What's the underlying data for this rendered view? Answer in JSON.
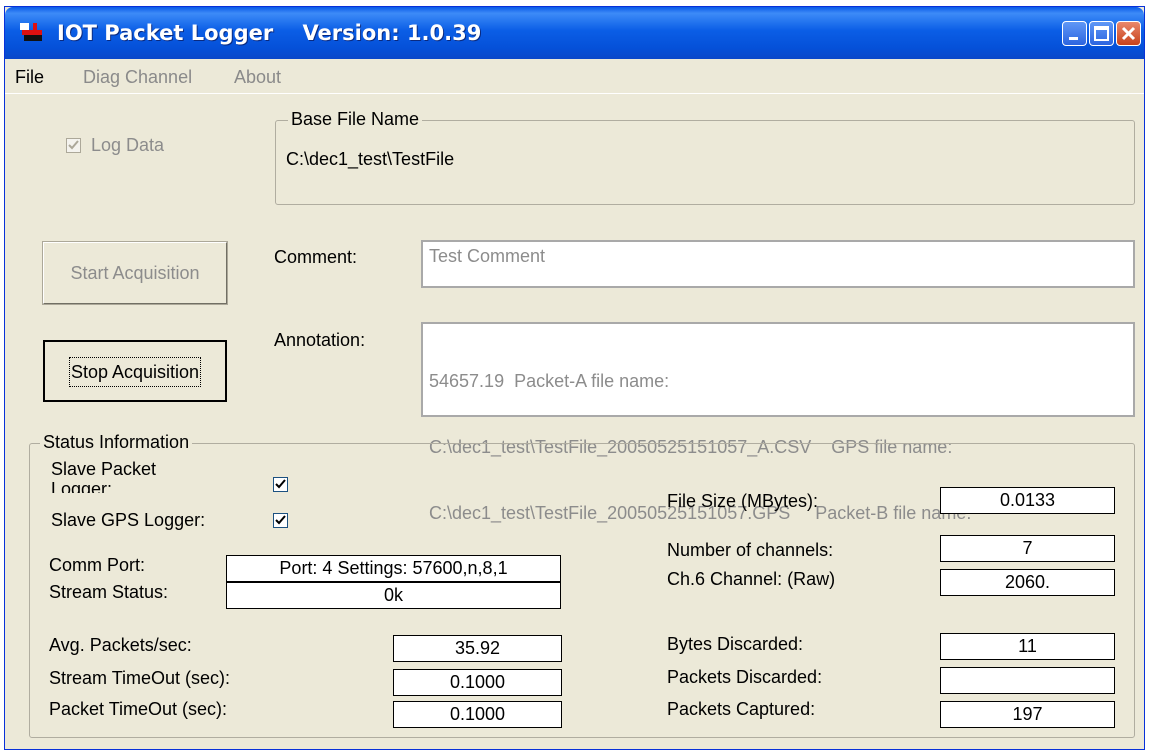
{
  "window": {
    "title": "IOT Packet Logger    Version: 1.0.39",
    "icon": "logger-icon",
    "controls": [
      "minimize-icon",
      "maximize-icon",
      "close-icon"
    ]
  },
  "menu": {
    "file": "File",
    "diag_channel": "Diag Channel",
    "about": "About"
  },
  "log_data": {
    "label": "Log Data",
    "checked": true
  },
  "base_file": {
    "group_label": "Base File Name",
    "value": "C:\\dec1_test\\TestFile"
  },
  "buttons": {
    "start": "Start Acquisition",
    "stop": "Stop Acquisition"
  },
  "comment": {
    "label": "Comment:",
    "value": "Test Comment"
  },
  "annotation": {
    "label": "Annotation:",
    "lines": [
      "54657.19  Packet-A file name:",
      "C:\\dec1_test\\TestFile_20050525151057_A.CSV    GPS file name:",
      "C:\\dec1_test\\TestFile_20050525151057.GPS     Packet-B file name:"
    ]
  },
  "status": {
    "group_label": "Status Information",
    "slave_packet_logger": {
      "label": "Slave Packet\nLogger:",
      "checked": true
    },
    "slave_gps_logger": {
      "label": "Slave GPS Logger:",
      "checked": true
    },
    "comm_port": {
      "label": "Comm Port:",
      "value": "Port:  4   Settings: 57600,n,8,1"
    },
    "stream_status": {
      "label": "Stream Status:",
      "value": "0k"
    },
    "avg_packets": {
      "label": "Avg. Packets/sec:",
      "value": "35.92"
    },
    "stream_timeout": {
      "label": "Stream TimeOut (sec):",
      "value": "0.1000"
    },
    "packet_timeout": {
      "label": "Packet TimeOut (sec):",
      "value": "0.1000"
    },
    "file_size": {
      "label": "File Size (MBytes):",
      "value": "0.0133"
    },
    "num_channels": {
      "label": "Number of channels:",
      "value": "7"
    },
    "ch6_channel": {
      "label": "Ch.6 Channel: (Raw)",
      "value": "2060."
    },
    "bytes_discarded": {
      "label": "Bytes Discarded:",
      "value": "11"
    },
    "packets_discarded": {
      "label": "Packets Discarded:",
      "value": ""
    },
    "packets_captured": {
      "label": "Packets Captured:",
      "value": "197"
    }
  },
  "colors": {
    "titlebar": "#0a5ae8",
    "window_face": "#ece9d8",
    "disabled_text": "#8c8c8c"
  }
}
